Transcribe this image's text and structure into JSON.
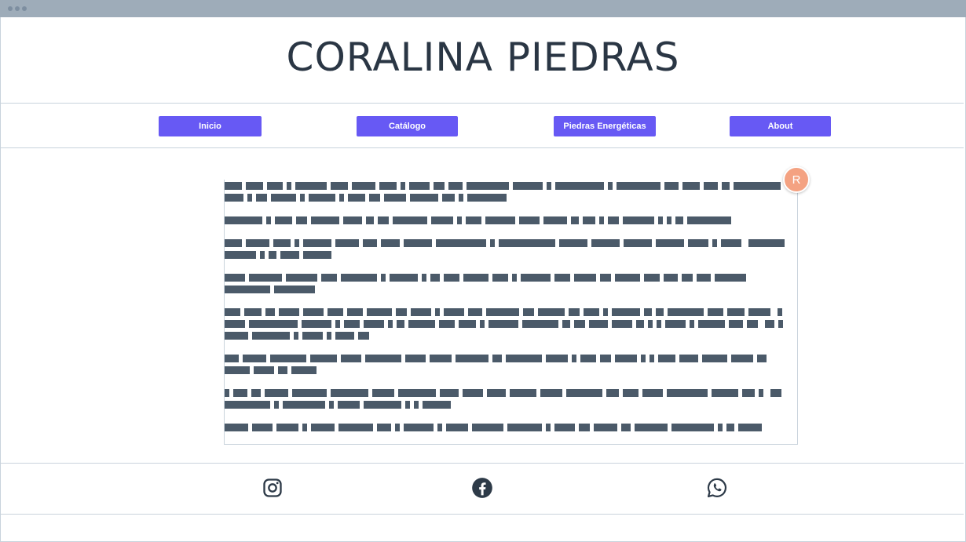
{
  "header": {
    "title": "CORALINA PIEDRAS"
  },
  "nav": {
    "items": [
      {
        "label": "Inicio"
      },
      {
        "label": "Catálogo"
      },
      {
        "label": "Piedras Energéticas"
      },
      {
        "label": "About"
      }
    ]
  },
  "avatar": {
    "initial": "R",
    "color": "#f4a282"
  },
  "footer": {
    "icons": [
      "instagram-icon",
      "facebook-icon",
      "whatsapp-icon"
    ]
  },
  "colors": {
    "accent": "#6759f4",
    "text": "#2a3644",
    "redacted": "#4b5a69"
  }
}
